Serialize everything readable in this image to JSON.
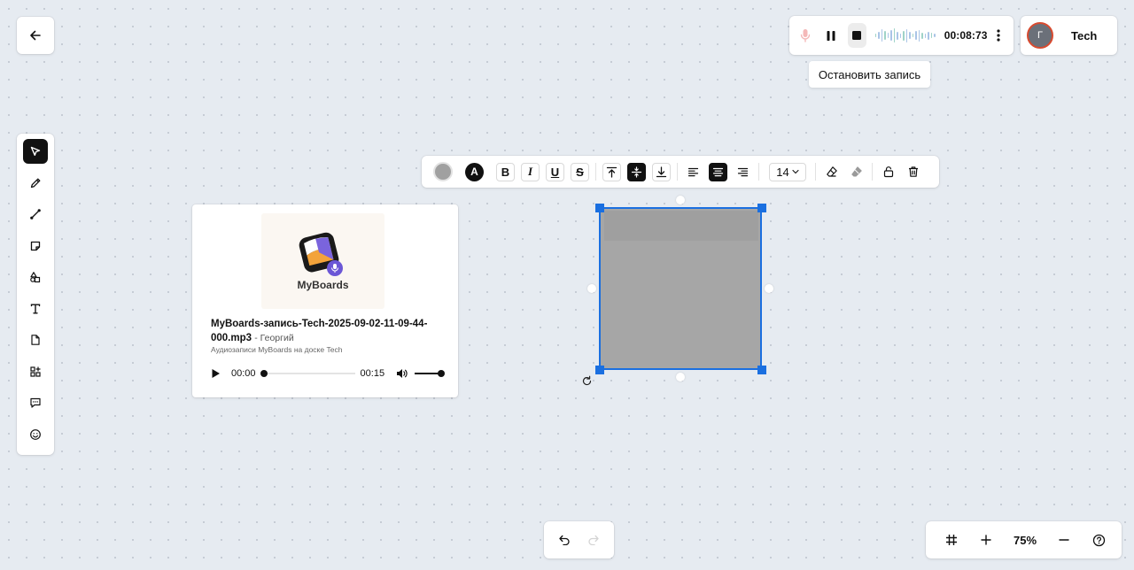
{
  "recorder": {
    "timer": "00:08:73",
    "tooltip": "Остановить запись"
  },
  "user": {
    "initial": "Г",
    "board_name": "Tech"
  },
  "toolbar": {
    "tools": [
      "select",
      "pen",
      "connector",
      "sticky-note",
      "shapes",
      "text",
      "file",
      "apps",
      "comment",
      "emoji"
    ]
  },
  "format_toolbar": {
    "text_color_letter": "A",
    "bold": "B",
    "italic": "I",
    "underline": "U",
    "strikethrough": "S",
    "font_size": "14"
  },
  "audio_card": {
    "brand": "MyBoards",
    "file_name": "MyBoards-запись-Tech-2025-09-02-11-09-44-000.mp3",
    "author": "- Георгий",
    "subtitle": "Аудиозаписи MyBoards на доске Tech",
    "current_time": "00:00",
    "duration": "00:15",
    "progress": 0,
    "volume": 1
  },
  "zoom": {
    "level": "75%"
  },
  "colors": {
    "selection": "#1a6fe0",
    "shape_fill": "#a6a6a6",
    "record_mic": "#f4b8b8",
    "avatar_border": "#d84a2f",
    "brand_purple": "#6b57d6"
  }
}
